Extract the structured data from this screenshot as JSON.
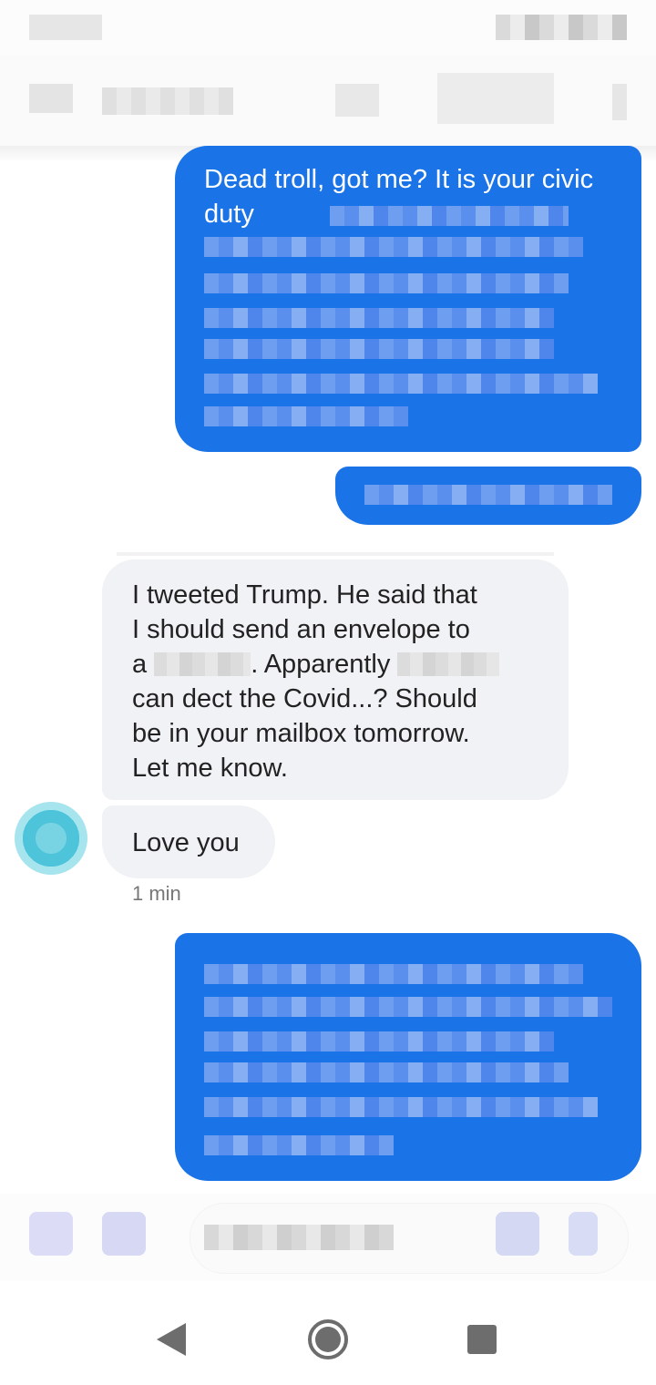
{
  "conversation": {
    "outgoing_1": {
      "visible_text": "Dead troll, got me? It is your civic duty"
    },
    "incoming_1": {
      "line1": "I tweeted Trump. He said that",
      "line2": "I should send an envelope to",
      "line3_prefix": "a",
      "line3_suffix": ". Apparently",
      "line4": "can dect the Covid...? Should",
      "line5": "be in your mailbox tomorrow.",
      "line6": "Let me know."
    },
    "incoming_2": {
      "text": "Love you"
    },
    "timestamp": "1 min"
  },
  "icons": {
    "nav_back": "back-triangle-icon",
    "nav_home": "home-circle-icon",
    "nav_recents": "recents-square-icon"
  },
  "colors": {
    "outgoing_bubble": "#1b73e8",
    "incoming_bubble": "#f1f2f6",
    "text_dark": "#222222",
    "timestamp": "#777777"
  }
}
